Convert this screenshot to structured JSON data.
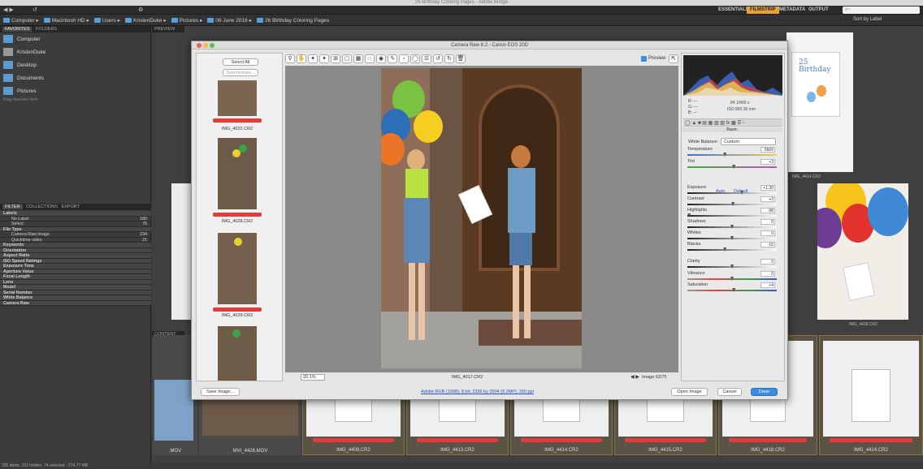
{
  "app": {
    "window_title": "26 Birthday Coloring Pages - Adobe Bridge"
  },
  "workspaces": [
    "ESSENTIALS",
    "FILMSTRIP",
    "METADATA",
    "OUTPUT"
  ],
  "active_workspace": "FILMSTRIP",
  "search_placeholder": "⌕~",
  "sort_label": "Sort by Label",
  "path": [
    "Computer",
    "Macintosh HD",
    "Users",
    "KristenDuke",
    "Pictures",
    "06 June 2016",
    "26 Birthday Coloring Pages"
  ],
  "left_tabs": [
    "FAVORITES",
    "FOLDERS"
  ],
  "favorites": [
    "Computer",
    "KristenDuke",
    "Desktop",
    "Documents",
    "Pictures"
  ],
  "favorites_hint": "Drag favorites here",
  "filter_tabs": [
    "FILTER",
    "COLLECTIONS",
    "EXPORT"
  ],
  "filters": [
    {
      "label": "Labels",
      "type": "cat"
    },
    {
      "label": "No Label",
      "count": "180",
      "type": "item"
    },
    {
      "label": "Select",
      "count": "75",
      "type": "item"
    },
    {
      "label": "File Type",
      "type": "cat"
    },
    {
      "label": "Camera Raw image",
      "count": "234",
      "type": "item"
    },
    {
      "label": "Quicktime video",
      "count": "21",
      "type": "item"
    },
    {
      "label": "Keywords",
      "type": "cat"
    },
    {
      "label": "Orientation",
      "type": "cat"
    },
    {
      "label": "Aspect Ratio",
      "type": "cat"
    },
    {
      "label": "ISO Speed Ratings",
      "type": "cat"
    },
    {
      "label": "Exposure Time",
      "type": "cat"
    },
    {
      "label": "Aperture Value",
      "type": "cat"
    },
    {
      "label": "Focal Length",
      "type": "cat"
    },
    {
      "label": "Lens",
      "type": "cat"
    },
    {
      "label": "Model",
      "type": "cat"
    },
    {
      "label": "Serial Number",
      "type": "cat"
    },
    {
      "label": "White Balance",
      "type": "cat"
    },
    {
      "label": "Camera Raw",
      "type": "cat"
    }
  ],
  "preview_tab": "PREVIEW",
  "content_tab": "CONTENT",
  "status_bar": "255 items, 101 hidden, 74 selected - 574.77 MB",
  "dialog": {
    "title": "Camera Raw 8.2  -  Canon EOS 20D",
    "select_all": "Select All",
    "synchronize": "Synchronize...",
    "thumbs": [
      "IMG_4022.CR2",
      "IMG_4028.CR2",
      "IMG_4029.CR2"
    ],
    "preview_label": "Preview",
    "zoom": "20.1%",
    "current_file": "IMG_4017.CR2",
    "image_counter": "Image 62/75",
    "cam_r": "R:  ---",
    "cam_g": "G:  ---",
    "cam_b": "B:  ---",
    "exif_line1": "f/4   1/400 s",
    "exif_line2": "ISO 800   35 mm",
    "panel_title": "Basic",
    "wb_label": "White Balance:",
    "wb_value": "Custom",
    "auto": "Auto",
    "default": "Default",
    "sliders": [
      {
        "name": "Temperature",
        "value": "5600",
        "pos": 0.42,
        "track": "temp"
      },
      {
        "name": "Tint",
        "value": "+3",
        "pos": 0.52,
        "track": "tint"
      },
      {
        "name": "Exposure",
        "value": "+1.30",
        "pos": 0.61,
        "track": "gray"
      },
      {
        "name": "Contrast",
        "value": "+3",
        "pos": 0.51,
        "track": "gray"
      },
      {
        "name": "Highlights",
        "value": "-98",
        "pos": 0.02,
        "track": "gray"
      },
      {
        "name": "Shadows",
        "value": "0",
        "pos": 0.5,
        "track": "gray"
      },
      {
        "name": "Whites",
        "value": "0",
        "pos": 0.5,
        "track": "gray"
      },
      {
        "name": "Blacks",
        "value": "-16",
        "pos": 0.42,
        "track": "gray"
      },
      {
        "name": "Clarity",
        "value": "0",
        "pos": 0.5,
        "track": "gray"
      },
      {
        "name": "Vibrance",
        "value": "0",
        "pos": 0.5,
        "track": "sat"
      },
      {
        "name": "Saturation",
        "value": "+4",
        "pos": 0.52,
        "track": "sat"
      }
    ],
    "save_image": "Save Image...",
    "workflow_link": "Adobe RGB (1998); 8 bit; 2336 by 3504 (8.2MP); 300 ppi",
    "open_image": "Open Image",
    "cancel": "Cancel",
    "done": "Done"
  },
  "filmstrip": [
    "MVI_4426.MOV",
    "IMG_4409.CR2",
    "IMG_4413.CR2",
    "IMG_4414.CR2",
    "IMG_4415.CR2",
    "IMG_4418.CR2",
    "IMG_4424.CR2"
  ],
  "filmstrip_first_partial": ".MOV",
  "right_caps": [
    "IMG_4414.CR2",
    "IMG_4428.CR2"
  ],
  "colors": {
    "accent": "#e8a23a",
    "label_red": "#e23c3c",
    "link_blue": "#2255cc",
    "done_blue": "#3c8de0"
  }
}
